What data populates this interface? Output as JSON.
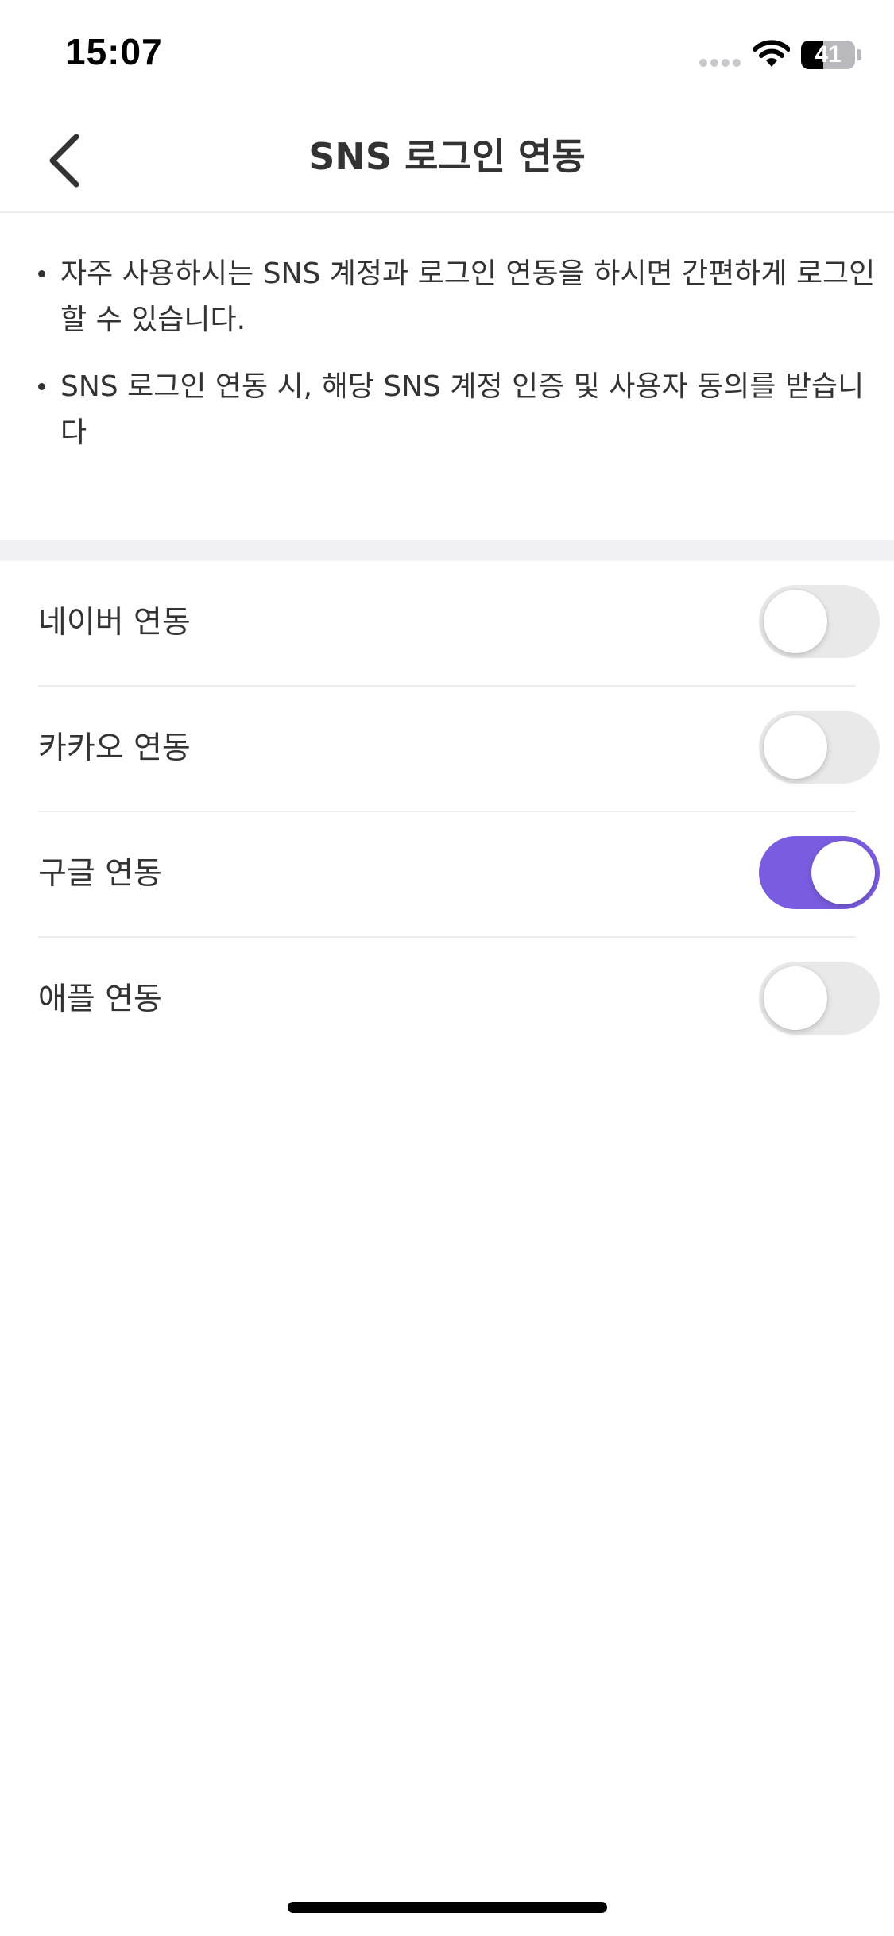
{
  "status_bar": {
    "time": "15:07",
    "battery_level": "41",
    "battery_fraction": 0.41,
    "icons": [
      "signal-dots-icon",
      "wifi-icon",
      "battery-icon"
    ]
  },
  "nav": {
    "title": "SNS 로그인 연동",
    "back_icon": "chevron-left-icon"
  },
  "info": {
    "notes": [
      "자주 사용하시는 SNS 계정과 로그인 연동을 하시면 간편하게 로그인 할 수 있습니다.",
      "SNS 로그인 연동 시, 해당 SNS 계정 인증 및 사용자 동의를 받습니다"
    ]
  },
  "sns_list": {
    "items": [
      {
        "label": "네이버 연동",
        "enabled": false
      },
      {
        "label": "카카오 연동",
        "enabled": false
      },
      {
        "label": "구글 연동",
        "enabled": true
      },
      {
        "label": "애플 연동",
        "enabled": false
      }
    ]
  },
  "colors": {
    "accent": "#7a5ce0",
    "toggle_off": "#e9e9ea",
    "text": "#333333",
    "divider": "#ececec",
    "section_background": "#f1f1f5"
  }
}
